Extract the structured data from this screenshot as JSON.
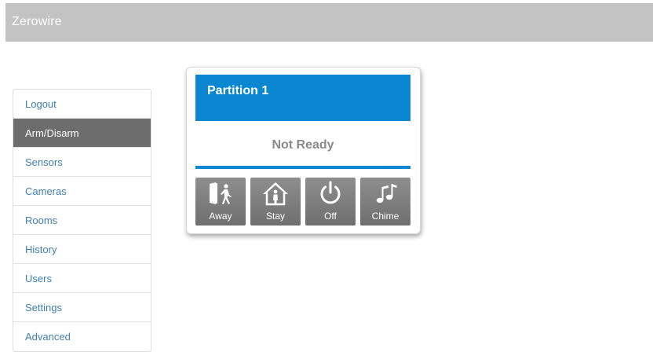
{
  "app": {
    "title": "Zerowire"
  },
  "sidebar": {
    "items": [
      {
        "label": "Logout"
      },
      {
        "label": "Arm/Disarm"
      },
      {
        "label": "Sensors"
      },
      {
        "label": "Cameras"
      },
      {
        "label": "Rooms"
      },
      {
        "label": "History"
      },
      {
        "label": "Users"
      },
      {
        "label": "Settings"
      },
      {
        "label": "Advanced"
      }
    ],
    "active": "Arm/Disarm"
  },
  "partition": {
    "title": "Partition 1",
    "status": "Not Ready",
    "buttons": [
      {
        "label": "Away",
        "icon": "away-icon"
      },
      {
        "label": "Stay",
        "icon": "stay-home-icon"
      },
      {
        "label": "Off",
        "icon": "power-icon"
      },
      {
        "label": "Chime",
        "icon": "music-note-icon"
      }
    ]
  },
  "colors": {
    "header_bar": "#c3c3c3",
    "accent_blue": "#0a87d0",
    "active_nav": "#6d6d6d",
    "nav_text": "#3f7fae",
    "button_gray": "#7d7d7d",
    "status_text": "#8a8a8a"
  }
}
